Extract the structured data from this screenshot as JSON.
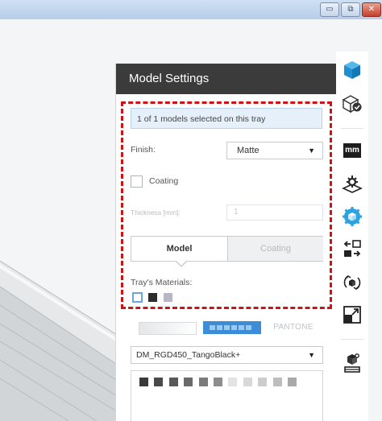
{
  "window": {
    "minimize_glyph": "▭",
    "restore_glyph": "⧉",
    "close_glyph": "✕"
  },
  "panel": {
    "title": "Model Settings",
    "selection_text": "1 of 1 models selected on this tray",
    "finish_label": "Finish:",
    "finish_value": "Matte",
    "coating_label": "Coating",
    "coating_checked": false,
    "thickness_label": "Thickness [mm]:",
    "thickness_value": "1",
    "tabs": [
      {
        "label": "Model",
        "active": true
      },
      {
        "label": "Coating",
        "active": false
      }
    ],
    "trays_materials_label": "Tray's Materials:",
    "tray_materials": [
      "#ffffff",
      "#2c2c2c",
      "#b9b5c5"
    ],
    "palette_tab_pantone": "PANTONE",
    "material_select_value": "DM_RGD450_TangoBlack+",
    "color_swatches": [
      "#3a3a3a",
      "#4a4a4a",
      "#595959",
      "#6a6a6a",
      "#7b7b7b",
      "#8d8d8d",
      "#e3e3e3",
      "#d8d8d8",
      "#cdcdcd",
      "#bebebe",
      "#a9a9a9"
    ]
  },
  "toolbar": {
    "items": [
      "model-cube-icon",
      "settings-check-icon",
      "mm-units-icon",
      "tray-settings-icon",
      "model-settings-icon",
      "move-arrange-icon",
      "rotate-icon",
      "scale-icon",
      "print-material-icon"
    ],
    "mm_label": "mm"
  },
  "colors": {
    "accent": "#1e9ad6",
    "highlight_dashed": "#cc1417",
    "header": "#3b3b3b"
  }
}
